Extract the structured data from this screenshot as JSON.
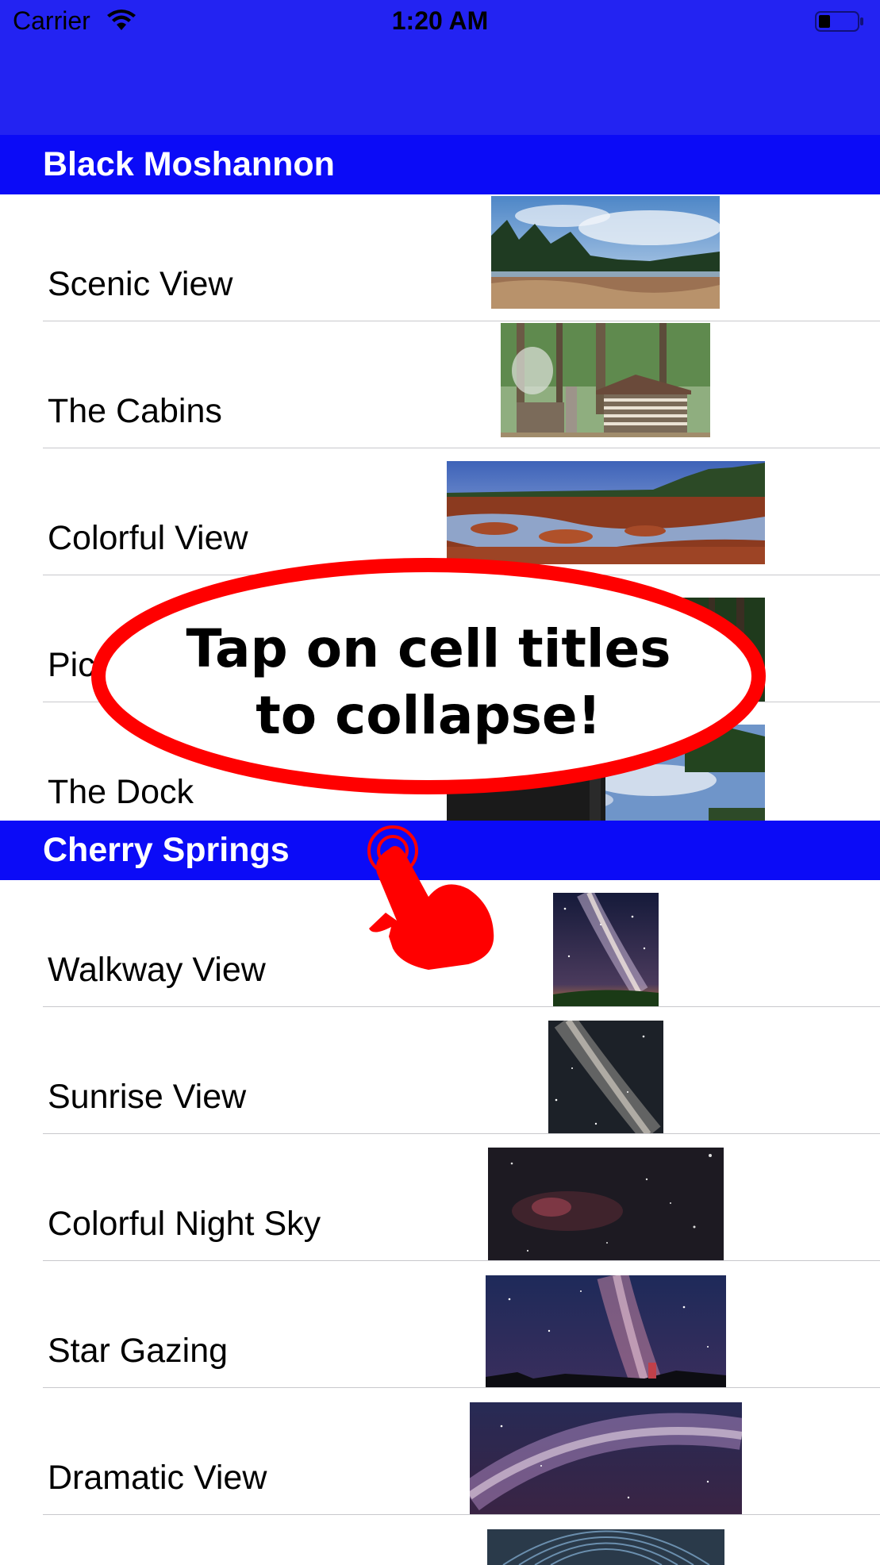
{
  "status_bar": {
    "carrier": "Carrier",
    "time": "1:20 AM",
    "background": "#2323f2",
    "icons": [
      "wifi-icon",
      "battery-icon"
    ]
  },
  "sections": [
    {
      "title": "Black Moshannon",
      "rows": [
        {
          "label": "Scenic View",
          "image": "scenic-view-photo"
        },
        {
          "label": "The Cabins",
          "image": "cabins-photo"
        },
        {
          "label": "Colorful View",
          "image": "colorful-view-photo"
        },
        {
          "label": "Pic",
          "image": "picnic-photo"
        },
        {
          "label": "The Dock",
          "image": "dock-photo"
        }
      ]
    },
    {
      "title": "Cherry Springs",
      "rows": [
        {
          "label": "Walkway View",
          "image": "milky-way-photo"
        },
        {
          "label": "Sunrise View",
          "image": "milky-way-photo"
        },
        {
          "label": "Colorful Night Sky",
          "image": "night-sky-photo"
        },
        {
          "label": "Star Gazing",
          "image": "star-gazing-photo"
        },
        {
          "label": "Dramatic View",
          "image": "milky-way-arc-photo"
        }
      ]
    }
  ],
  "callout": {
    "line1": "Tap on cell titles",
    "line2": "to collapse!",
    "color": "#ff0000"
  },
  "colors": {
    "section_header": "#0b0bf7",
    "accent_red": "#ff0000"
  }
}
